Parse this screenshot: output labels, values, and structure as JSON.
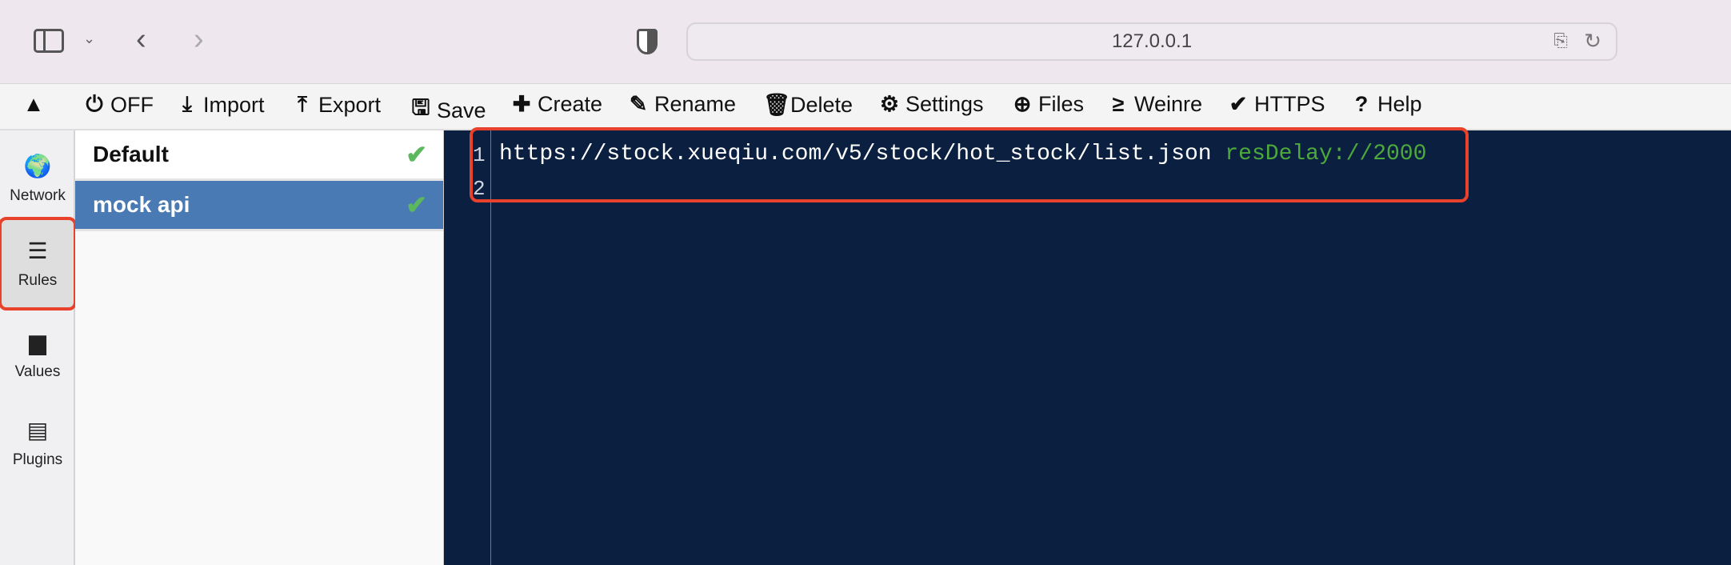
{
  "browser": {
    "url": "127.0.0.1",
    "icons": [
      "sidebar-icon",
      "chevron-down-icon",
      "back-icon",
      "forward-icon",
      "shield-icon",
      "translate-icon",
      "reload-icon"
    ]
  },
  "toolbar": [
    {
      "label": "",
      "icon": "▲",
      "name": "collapse"
    },
    {
      "label": "OFF",
      "icon": "⏻",
      "name": "off"
    },
    {
      "label": "Import",
      "icon": "⤓",
      "name": "import"
    },
    {
      "label": "Export",
      "icon": "⤒",
      "name": "export"
    },
    {
      "label": "Save",
      "icon": "🖫",
      "name": "save"
    },
    {
      "label": "Create",
      "icon": "✚",
      "name": "create"
    },
    {
      "label": "Rename",
      "icon": "✎",
      "name": "rename"
    },
    {
      "label": "Delete",
      "icon": "🗑",
      "name": "delete"
    },
    {
      "label": "Settings",
      "icon": "⚙",
      "name": "settings"
    },
    {
      "label": "Files",
      "icon": "⊕",
      "name": "files"
    },
    {
      "label": "Weinre",
      "icon": "≥",
      "name": "weinre"
    },
    {
      "label": "HTTPS",
      "icon": "✔",
      "name": "https"
    },
    {
      "label": "Help",
      "icon": "?",
      "name": "help"
    }
  ],
  "sidebar": [
    {
      "label": "Network",
      "icon": "🌍"
    },
    {
      "label": "Rules",
      "icon": "☰",
      "active": true
    },
    {
      "label": "Values",
      "icon": "▆"
    },
    {
      "label": "Plugins",
      "icon": "▤"
    }
  ],
  "rules": [
    {
      "name": "Default",
      "enabled": true
    },
    {
      "name": "mock api",
      "enabled": true,
      "selected": true
    }
  ],
  "editor": {
    "lines": [
      "1",
      "2"
    ],
    "url": "https://stock.xueqiu.com/v5/stock/hot_stock/list.json ",
    "directive": "resDelay://2000"
  },
  "colors": {
    "selected": "#4a7ab3",
    "check": "#5cb85c",
    "editor_bg": "#0b2040",
    "highlight": "#e8412c",
    "directive": "#4da93c"
  }
}
